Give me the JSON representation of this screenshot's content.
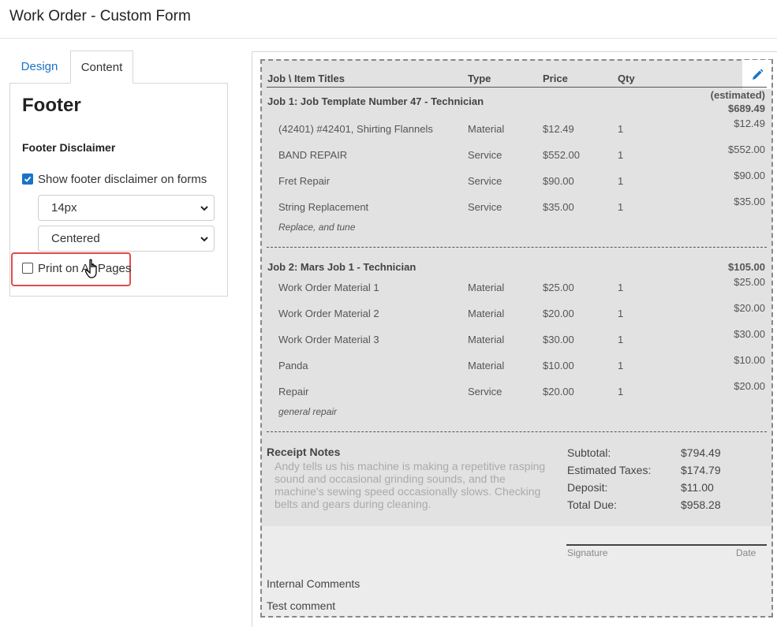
{
  "page": {
    "title": "Work Order - Custom Form"
  },
  "tabs": [
    {
      "label": "Design"
    },
    {
      "label": "Content"
    }
  ],
  "panel": {
    "heading": "Footer",
    "section": "Footer Disclaimer",
    "show_disclaimer": {
      "label": "Show footer disclaimer on forms",
      "checked": true
    },
    "font_size_select": {
      "value": "14px"
    },
    "alignment_select": {
      "value": "Centered"
    },
    "print_all_pages": {
      "label": "Print on All Pages",
      "checked": false
    }
  },
  "form": {
    "columns": {
      "title": "Job \\ Item Titles",
      "type": "Type",
      "price": "Price",
      "qty": "Qty"
    },
    "jobs": [
      {
        "title": "Job 1: Job Template Number 47 - Technician",
        "estimated": "(estimated)",
        "total": "$689.49",
        "items": [
          {
            "name": "(42401) #42401, Shirting Flannels",
            "type": "Material",
            "price": "$12.49",
            "qty": "1",
            "amount": "$12.49"
          },
          {
            "name": "BAND REPAIR",
            "type": "Service",
            "price": "$552.00",
            "qty": "1",
            "amount": "$552.00"
          },
          {
            "name": "Fret Repair",
            "type": "Service",
            "price": "$90.00",
            "qty": "1",
            "amount": "$90.00"
          },
          {
            "name": "String Replacement",
            "type": "Service",
            "price": "$35.00",
            "qty": "1",
            "amount": "$35.00"
          }
        ],
        "note": "Replace, and tune"
      },
      {
        "title": "Job 2: Mars Job 1 - Technician",
        "total": "$105.00",
        "items": [
          {
            "name": "Work Order Material 1",
            "type": "Material",
            "price": "$25.00",
            "qty": "1",
            "amount": "$25.00"
          },
          {
            "name": "Work Order Material 2",
            "type": "Material",
            "price": "$20.00",
            "qty": "1",
            "amount": "$20.00"
          },
          {
            "name": "Work Order Material 3",
            "type": "Material",
            "price": "$30.00",
            "qty": "1",
            "amount": "$30.00"
          },
          {
            "name": "Panda",
            "type": "Material",
            "price": "$10.00",
            "qty": "1",
            "amount": "$10.00"
          },
          {
            "name": "Repair",
            "type": "Service",
            "price": "$20.00",
            "qty": "1",
            "amount": "$20.00"
          }
        ],
        "note": "general repair"
      }
    ],
    "receipt_notes": {
      "title": "Receipt Notes",
      "body": "Andy tells us his machine is making a repetitive rasping sound and occasional grinding sounds, and the machine's sewing speed occasionally slows. Checking belts and gears during cleaning."
    },
    "totals": [
      {
        "label": "Subtotal:",
        "value": "$794.49"
      },
      {
        "label": "Estimated Taxes:",
        "value": "$174.79"
      },
      {
        "label": "Deposit:",
        "value": "$11.00"
      },
      {
        "label": "Total Due:",
        "value": "$958.28"
      }
    ],
    "signature_label": "Signature",
    "date_label": "Date",
    "internal_comments_label": "Internal Comments",
    "internal_comment": "Test comment"
  },
  "colors": {
    "accent": "#1a73c8",
    "highlight": "#e04c4c"
  },
  "icons": {
    "edit": "pencil-icon",
    "cursor": "hand-pointer-icon",
    "dropdown": "chevron-down-icon"
  }
}
